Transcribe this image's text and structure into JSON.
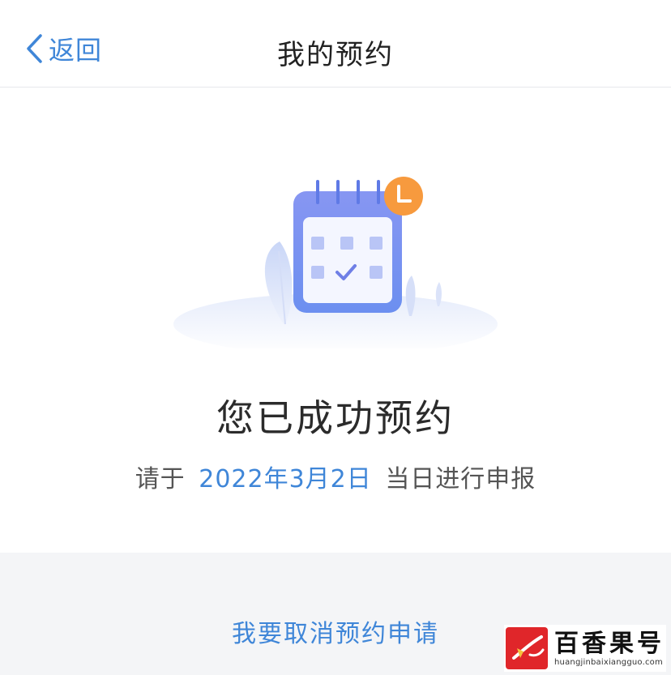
{
  "header": {
    "back_label": "返回",
    "title": "我的预约"
  },
  "illustration": {
    "icon": "calendar-check-icon",
    "badge_icon": "clock-icon",
    "accent_color": "#f79a3e",
    "calendar_color": "#7b8ff0"
  },
  "result": {
    "heading": "您已成功预约",
    "notice_prefix": "请于",
    "date": "2022年3月2日",
    "notice_suffix": "当日进行申报"
  },
  "actions": {
    "cancel_label": "我要取消预约申请"
  },
  "watermark": {
    "name": "百香果号",
    "url": "huangjinbaixiangguo.com"
  },
  "colors": {
    "link": "#3f86d8",
    "bottom_bg": "#f4f5f7"
  }
}
